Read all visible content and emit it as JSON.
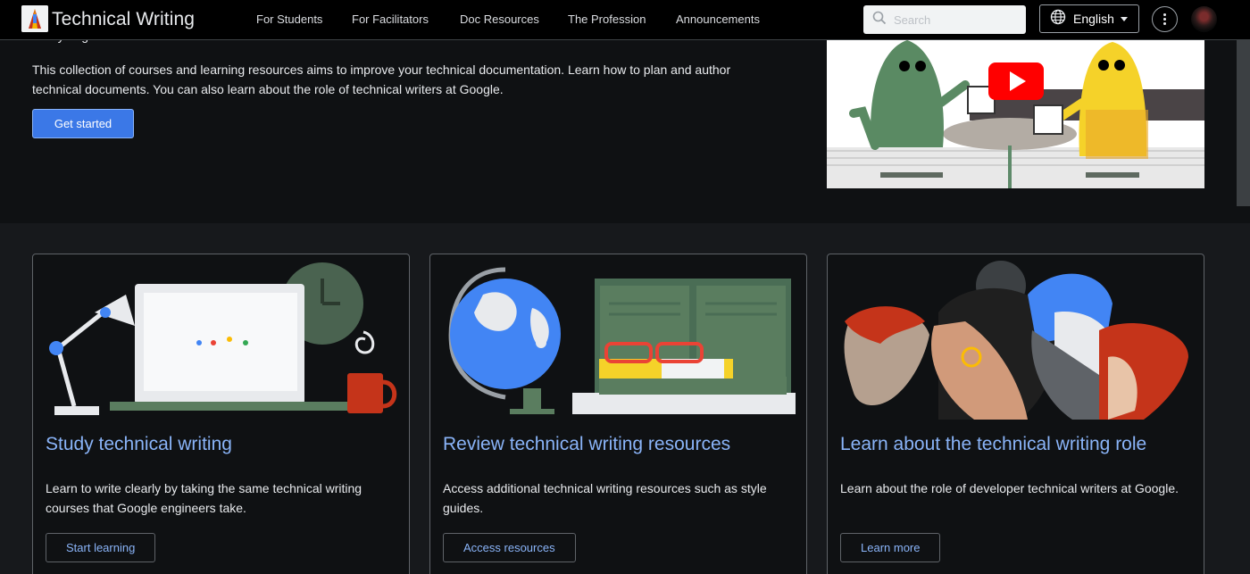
{
  "header": {
    "site_title": "Technical Writing",
    "nav": [
      "For Students",
      "For Facilitators",
      "Doc Resources",
      "The Profession",
      "Announcements"
    ],
    "search_placeholder": "Search",
    "language": "English",
    "icons": {
      "search": "search-icon",
      "language": "globe-icon",
      "more": "more-vert-icon",
      "dropdown": "caret-down-icon"
    }
  },
  "hero": {
    "clipped_line": "Every engineer is also a writer.",
    "description": "This collection of courses and learning resources aims to improve your technical documentation. Learn how to plan and author technical documents. You can also learn about the role of technical writers at Google.",
    "cta": "Get started"
  },
  "cards": [
    {
      "title": "Study technical writing",
      "description": "Learn to write clearly by taking the same technical writing courses that Google engineers take.",
      "button": "Start learning"
    },
    {
      "title": "Review technical writing resources",
      "description": "Access additional technical writing resources such as style guides.",
      "button": "Access resources"
    },
    {
      "title": "Learn about the technical writing role",
      "description": "Learn about the role of developer technical writers at Google.",
      "button": "Learn more"
    }
  ],
  "colors": {
    "accent": "#8ab4f8",
    "primary_button": "#3b78e7",
    "background": "#0f1113"
  }
}
